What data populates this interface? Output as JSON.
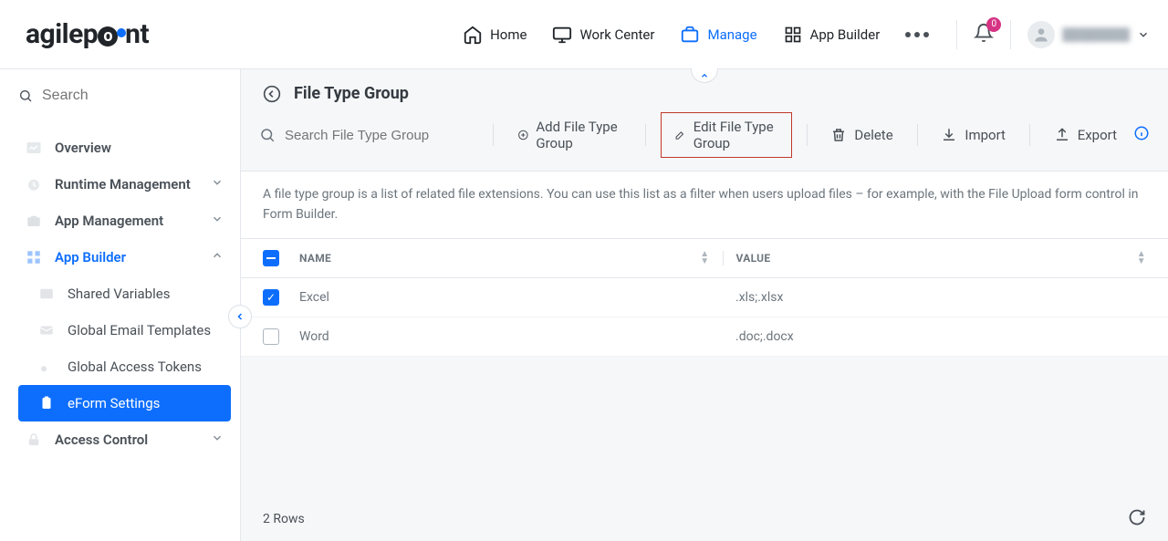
{
  "header": {
    "brand": "agilepoint",
    "nav": {
      "home": "Home",
      "work_center": "Work Center",
      "manage": "Manage",
      "app_builder": "App Builder"
    },
    "notifications_count": "0",
    "user_name": "████████"
  },
  "sidebar": {
    "search_placeholder": "Search",
    "items": {
      "overview": "Overview",
      "runtime_mgmt": "Runtime Management",
      "app_mgmt": "App Management",
      "app_builder": "App Builder",
      "shared_vars": "Shared Variables",
      "email_templates": "Global Email Templates",
      "access_tokens": "Global Access Tokens",
      "eform_settings": "eForm Settings",
      "access_control": "Access Control"
    }
  },
  "page": {
    "title": "File Type Group",
    "search_placeholder": "Search File Type Group",
    "toolbar": {
      "add": "Add File Type Group",
      "edit": "Edit File Type Group",
      "delete": "Delete",
      "import": "Import",
      "export": "Export"
    },
    "description": "A file type group is a list of related file extensions. You can use this list as a filter when users upload files – for example, with the File Upload form control in Form Builder.",
    "columns": {
      "name": "NAME",
      "value": "VALUE"
    },
    "rows": [
      {
        "checked": true,
        "name": "Excel",
        "value": ".xls;.xlsx"
      },
      {
        "checked": false,
        "name": "Word",
        "value": ".doc;.docx"
      }
    ],
    "footer_count": "2 Rows"
  }
}
